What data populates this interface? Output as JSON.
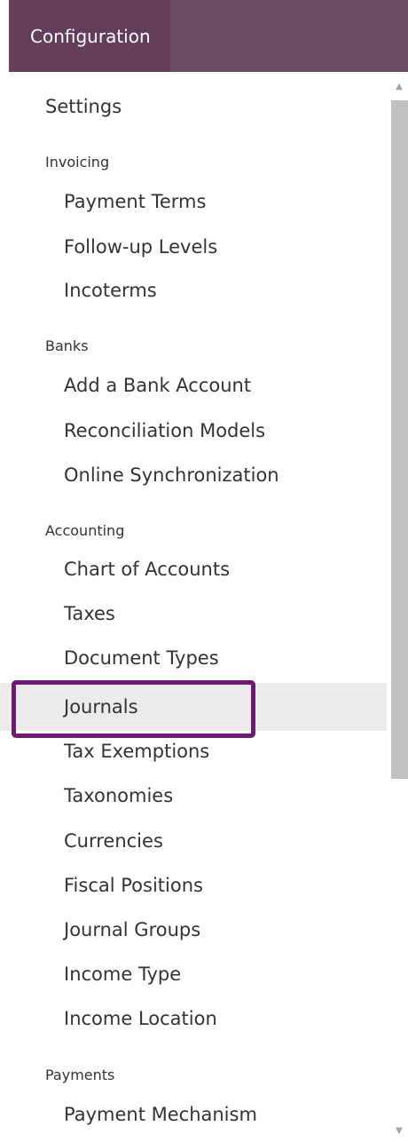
{
  "header": {
    "title": "Configuration"
  },
  "menu": {
    "settings": "Settings",
    "sections": [
      {
        "label": "Invoicing",
        "items": [
          "Payment Terms",
          "Follow-up Levels",
          "Incoterms"
        ]
      },
      {
        "label": "Banks",
        "items": [
          "Add a Bank Account",
          "Reconciliation Models",
          "Online Synchronization"
        ]
      },
      {
        "label": "Accounting",
        "items": [
          "Chart of Accounts",
          "Taxes",
          "Document Types",
          "Journals",
          "Tax Exemptions",
          "Taxonomies",
          "Currencies",
          "Fiscal Positions",
          "Journal Groups",
          "Income Type",
          "Income Location"
        ]
      },
      {
        "label": "Payments",
        "items": [
          "Payment Mechanism"
        ]
      }
    ],
    "selected_item": "Journals"
  },
  "scrollbar": {
    "up_arrow": "▲",
    "down_arrow": "▼"
  },
  "colors": {
    "header_bg": "#6b4a65",
    "header_tab_bg": "#623e5a",
    "highlight_border": "#6f1a72",
    "active_row_bg": "#ebebeb"
  }
}
